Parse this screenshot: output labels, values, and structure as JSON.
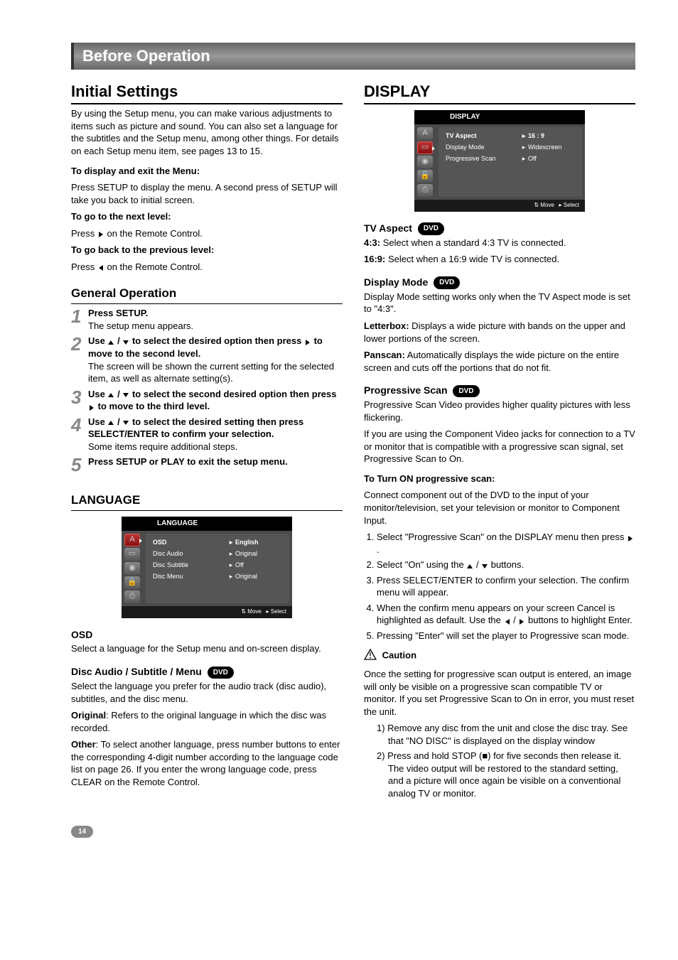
{
  "page_title": "Before Operation",
  "page_number": "14",
  "left": {
    "h_initial": "Initial Settings",
    "intro": "By using the Setup menu, you can make various adjustments to items such as picture and sound. You can also set a language for the subtitles and the Setup menu, among other things. For details on each Setup menu item, see pages 13 to 15.",
    "disp_exit_h": "To display and exit the Menu:",
    "disp_exit_b": "Press SETUP to display the menu. A second press of SETUP will take you back to initial screen.",
    "next_h": "To go to the next level:",
    "next_b_pre": "Press ",
    "next_b_post": " on the Remote Control.",
    "prev_h": "To go back to the previous level:",
    "prev_b_pre": "Press ",
    "prev_b_post": " on the Remote Control.",
    "h_general": "General Operation",
    "steps": [
      {
        "num": "1",
        "bold": "Press SETUP.",
        "body": "The setup menu appears."
      },
      {
        "num": "2",
        "bold_pre": "Use ",
        "bold_mid": " / ",
        "bold_post": " to select the desired option then press ",
        "bold_end": " to move to the second level.",
        "body": "The screen will be shown the current setting for the selected item, as well as alternate setting(s)."
      },
      {
        "num": "3",
        "bold_pre": "Use ",
        "bold_mid": " / ",
        "bold_post": " to select the second desired option then press ",
        "bold_end": " to move to the third level.",
        "body": ""
      },
      {
        "num": "4",
        "bold_pre": "Use ",
        "bold_mid": " / ",
        "bold_post": " to select the desired setting then press SELECT/ENTER to confirm your selection.",
        "bold_end": "",
        "body": "Some items require additional steps."
      },
      {
        "num": "5",
        "bold": "Press SETUP or PLAY to exit the setup menu.",
        "body": ""
      }
    ],
    "h_language": "LANGUAGE",
    "osd_lang": {
      "header": "LANGUAGE",
      "rows": [
        {
          "label": "OSD",
          "val": "English",
          "hl": true
        },
        {
          "label": "Disc Audio",
          "val": "Original"
        },
        {
          "label": "Disc Subtitle",
          "val": "Off"
        },
        {
          "label": "Disc Menu",
          "val": "Original"
        }
      ],
      "footer_move": "Move",
      "footer_select": "Select"
    },
    "osd_h": "OSD",
    "osd_b": "Select a language for the Setup menu and on-screen display.",
    "disc_h": "Disc Audio / Subtitle / Menu",
    "dvd": "DVD",
    "disc_b": "Select the language you prefer for the audio track (disc audio), subtitles, and the disc menu.",
    "orig_h": "Original",
    "orig_b": ": Refers to the original language in which the disc was recorded.",
    "other_h": "Other",
    "other_b": ": To select another language, press number buttons to enter the corresponding 4-digit number according to the language code list on page 26. If you enter the wrong language code, press CLEAR on the Remote Control."
  },
  "right": {
    "h_display": "DISPLAY",
    "osd_disp": {
      "header": "DISPLAY",
      "rows": [
        {
          "label": "TV Aspect",
          "val": "16 : 9",
          "hl": true
        },
        {
          "label": "Display Mode",
          "val": "Widescreen"
        },
        {
          "label": "Progressive Scan",
          "val": "Off"
        }
      ],
      "footer_move": "Move",
      "footer_select": "Select"
    },
    "tvaspect_h": "TV Aspect",
    "dvd": "DVD",
    "tv43_h": "4:3:",
    "tv43_b": " Select when a standard 4:3 TV is connected.",
    "tv169_h": "16:9:",
    "tv169_b": " Select when a 16:9 wide TV is connected.",
    "dm_h": "Display Mode",
    "dm_intro": "Display Mode setting works only when the TV Aspect mode is set to \"4:3\".",
    "lb_h": "Letterbox:",
    "lb_b": " Displays a wide picture with bands on the upper and lower portions of the screen.",
    "ps_h": "Panscan:",
    "ps_b": " Automatically displays the wide picture on the entire screen and cuts off the portions that do not fit.",
    "prog_h": "Progressive Scan",
    "prog_p1": "Progressive Scan Video provides higher quality pictures with less flickering.",
    "prog_p2": "If you are using the Component Video jacks for connection to a TV or monitor that is compatible with a progressive scan signal, set Progressive Scan to On.",
    "turn_on_h": "To Turn ON progressive scan:",
    "turn_on_b": "Connect component out of the DVD to the input of your monitor/television, set your television or monitor to Component Input.",
    "ol1_pre": "Select \"Progressive Scan\" on the DISPLAY menu then press ",
    "ol1_post": ".",
    "ol2_pre": "Select \"On\" using the ",
    "ol2_mid": " / ",
    "ol2_post": " buttons.",
    "ol3": "Press SELECT/ENTER to confirm your selection. The confirm menu will appear.",
    "ol4_pre": "When the confirm menu appears on your screen Cancel is highlighted as default. Use the ",
    "ol4_mid": "/ ",
    "ol4_post": " buttons to highlight Enter.",
    "ol5": "Pressing \"Enter\" will set the player to Progressive scan mode.",
    "caution_h": "Caution",
    "caution_b": "Once the setting for progressive scan output is entered, an image will only be visible on a progressive scan compatible TV or monitor. If you set Progressive Scan to On in error, you must reset the unit.",
    "c1": "Remove any disc from the unit and close the disc tray. See that \"NO DISC\" is displayed on the display window",
    "c2_pre": "Press and hold STOP (",
    "c2_post": ") for five seconds then release it. The video output will be restored to the standard setting, and a picture will once again be visible on a conventional analog TV or monitor.",
    "stop_glyph": "■"
  }
}
